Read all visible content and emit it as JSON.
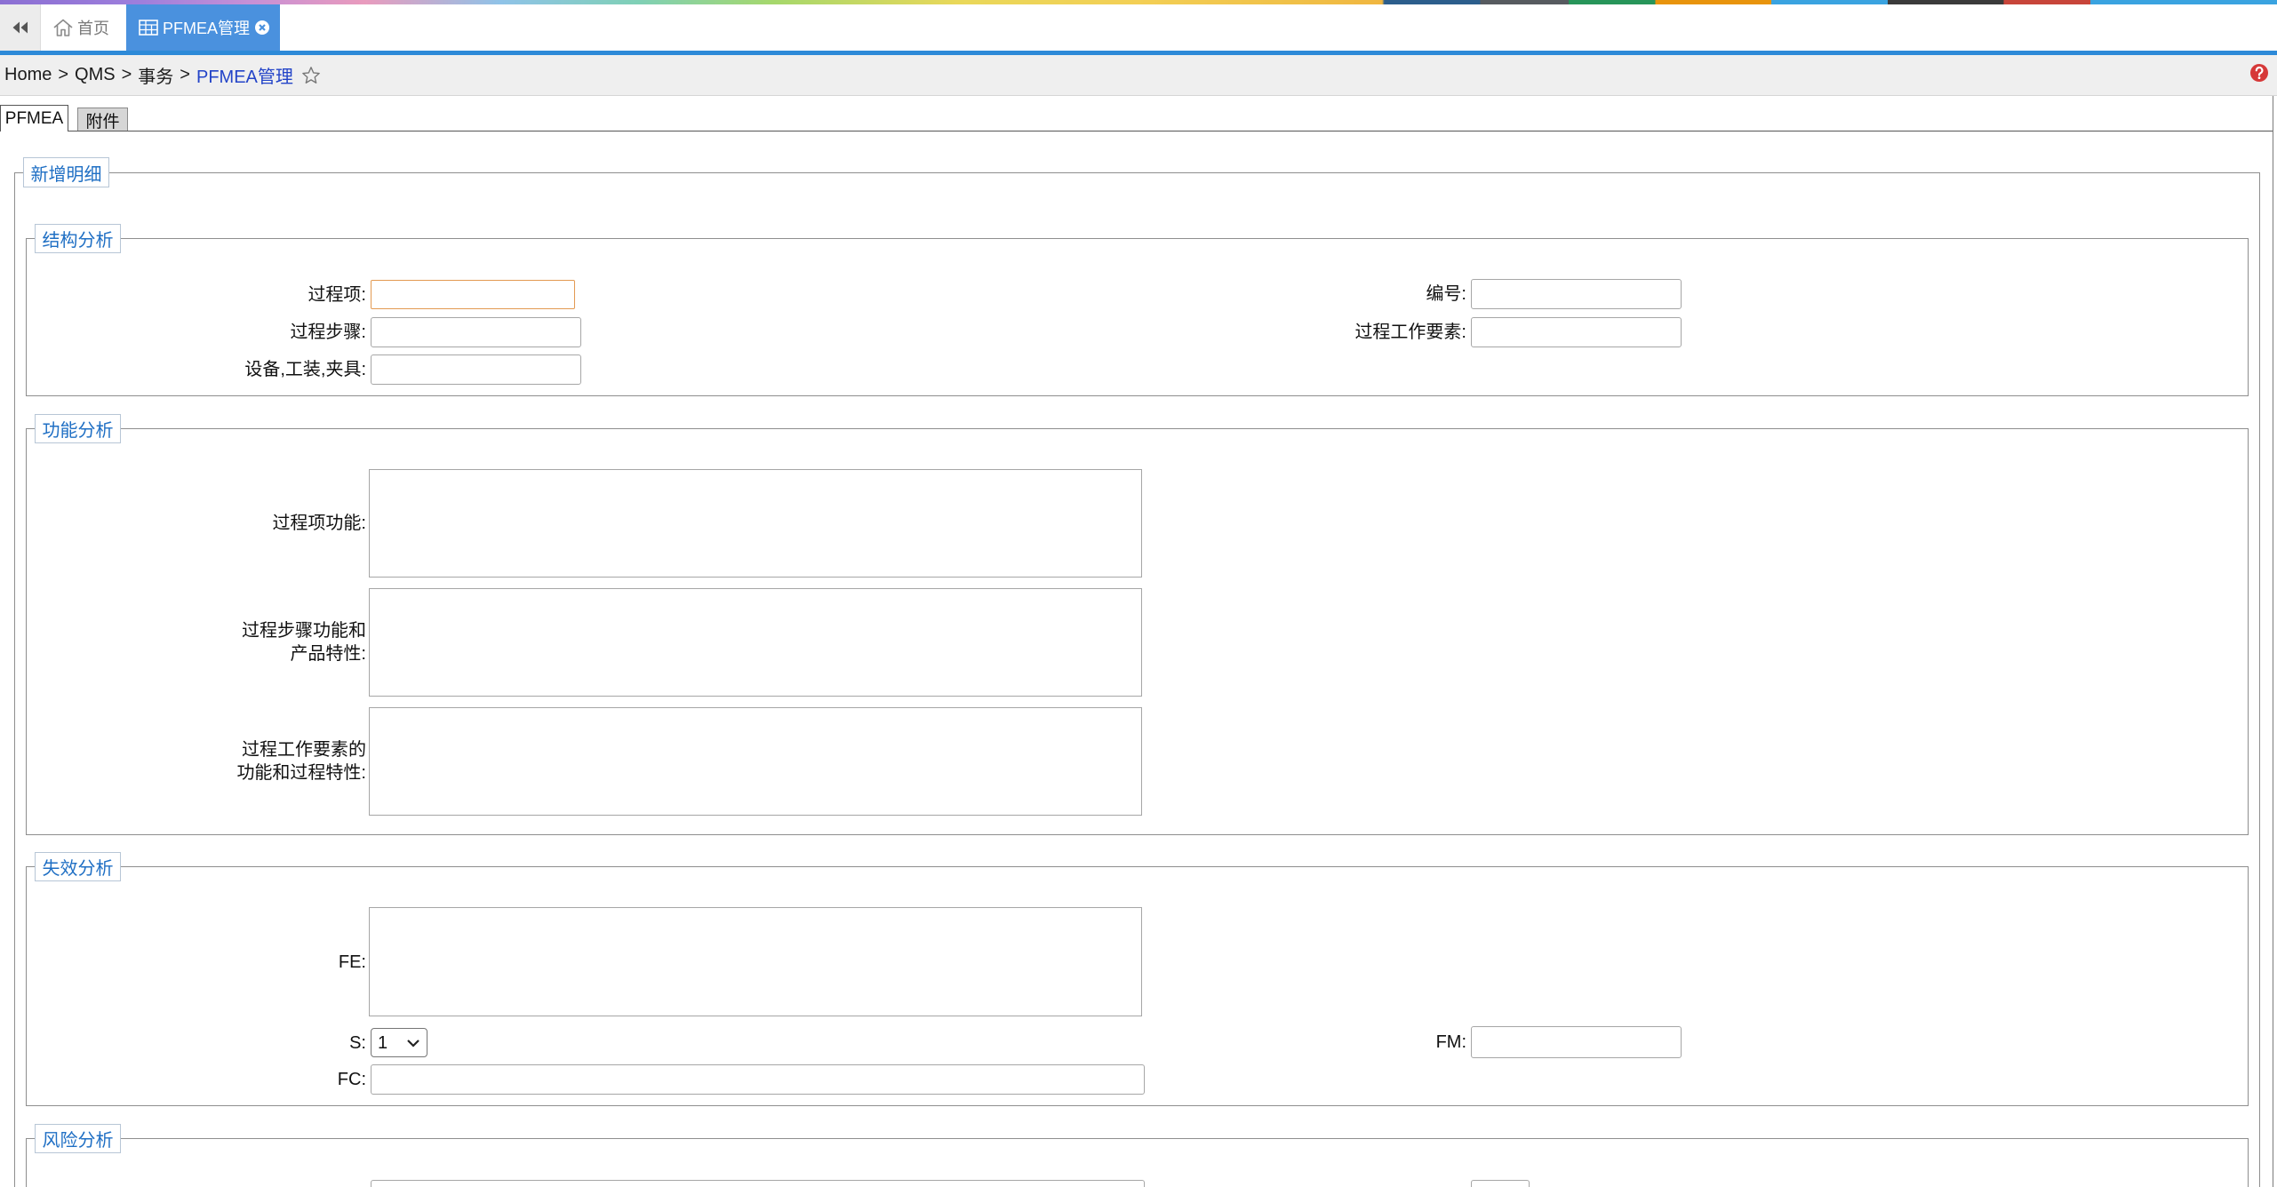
{
  "theme": {
    "accent": "#2d8ad8",
    "tab_active_bg": "#4a91de",
    "legend_text": "#1f6fc4",
    "breadcrumb_current": "#2344c8",
    "focus_border": "#e39a52",
    "help_icon": "#d63838"
  },
  "tabbar": {
    "collapse_icon": "double-chevron-left-icon",
    "tabs": [
      {
        "label": "首页",
        "icon": "home-icon",
        "active": false
      },
      {
        "label": "PFMEA管理",
        "icon": "table-icon",
        "active": true,
        "close_icon": "close-circle-icon"
      }
    ]
  },
  "breadcrumb": {
    "items": [
      "Home",
      "QMS",
      "事务"
    ],
    "separator": ">",
    "current": "PFMEA管理",
    "favorite_icon": "star-outline-icon",
    "help_icon": "help-icon"
  },
  "page_tabs": [
    {
      "label": "PFMEA",
      "active": true
    },
    {
      "label": "附件",
      "active": false
    }
  ],
  "form": {
    "title": "新增明细",
    "structure_analysis": {
      "legend": "结构分析",
      "process_item": {
        "label": "过程项:",
        "value": "",
        "focused": true
      },
      "number": {
        "label": "编号:",
        "value": ""
      },
      "process_step": {
        "label": "过程步骤:",
        "value": ""
      },
      "process_work_element": {
        "label": "过程工作要素:",
        "value": ""
      },
      "equipment_tooling_fixture": {
        "label": "设备,工装,夹具:",
        "value": ""
      }
    },
    "function_analysis": {
      "legend": "功能分析",
      "process_item_function": {
        "label_lines": [
          "过程项功能:"
        ],
        "value": ""
      },
      "process_step_function": {
        "label_lines": [
          "过程步骤功能和",
          "产品特性:"
        ],
        "value": ""
      },
      "work_element_function": {
        "label_lines": [
          "过程工作要素的",
          "功能和过程特性:"
        ],
        "value": ""
      }
    },
    "failure_analysis": {
      "legend": "失效分析",
      "fe": {
        "label": "FE:",
        "value": ""
      },
      "s": {
        "label": "S:",
        "selected": "1",
        "icon": "chevron-down-icon"
      },
      "fm": {
        "label": "FM:",
        "value": ""
      },
      "fc": {
        "label": "FC:",
        "value": ""
      }
    },
    "risk_analysis": {
      "legend": "风险分析"
    }
  }
}
